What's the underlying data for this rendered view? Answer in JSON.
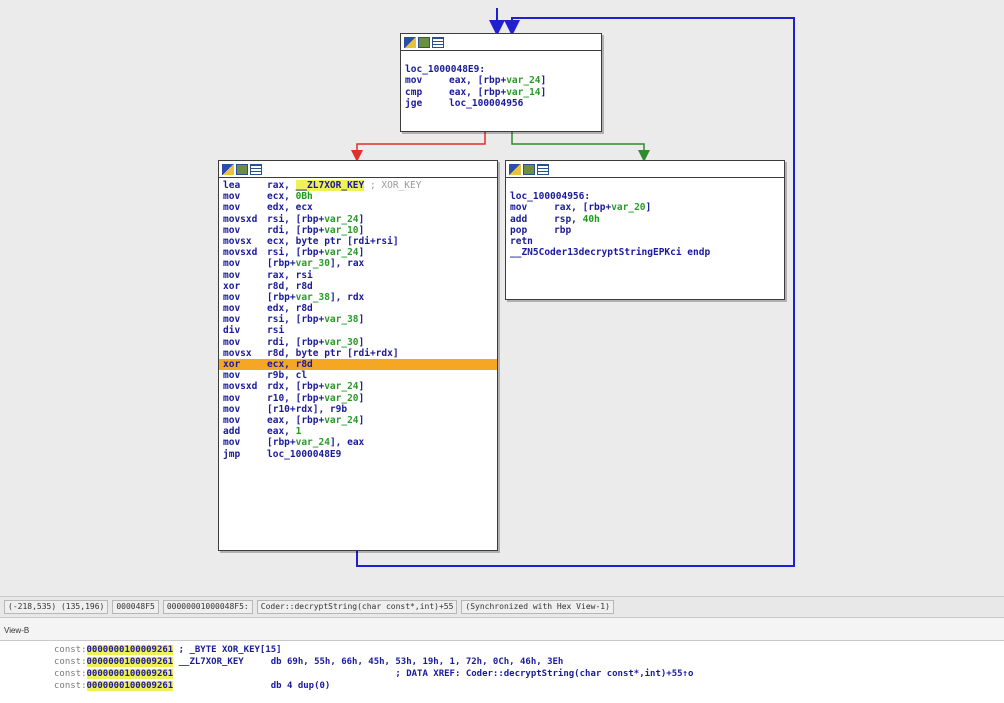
{
  "block_top": {
    "label": "loc_1000048E9:",
    "rows": [
      {
        "mnem": "mov",
        "parts": [
          {
            "t": "eax, [rbp+",
            "c": "op"
          },
          {
            "t": "var_24",
            "c": "var"
          },
          {
            "t": "]",
            "c": "op"
          }
        ]
      },
      {
        "mnem": "cmp",
        "parts": [
          {
            "t": "eax, [rbp+",
            "c": "op"
          },
          {
            "t": "var_14",
            "c": "var"
          },
          {
            "t": "]",
            "c": "op"
          }
        ]
      },
      {
        "mnem": "jge",
        "parts": [
          {
            "t": "loc_100004956",
            "c": "op"
          }
        ]
      }
    ]
  },
  "block_left": {
    "rows": [
      {
        "mnem": "lea",
        "parts": [
          {
            "t": "rax, ",
            "c": "op"
          },
          {
            "t": "__ZL7XOR_KEY",
            "c": "hl"
          },
          {
            "t": " ; XOR_KEY",
            "c": "cmt"
          }
        ]
      },
      {
        "mnem": "mov",
        "parts": [
          {
            "t": "ecx, ",
            "c": "op"
          },
          {
            "t": "0Bh",
            "c": "imm"
          }
        ]
      },
      {
        "mnem": "mov",
        "parts": [
          {
            "t": "edx, ecx",
            "c": "op"
          }
        ]
      },
      {
        "mnem": "movsxd",
        "parts": [
          {
            "t": "rsi, [rbp+",
            "c": "op"
          },
          {
            "t": "var_24",
            "c": "var"
          },
          {
            "t": "]",
            "c": "op"
          }
        ]
      },
      {
        "mnem": "mov",
        "parts": [
          {
            "t": "rdi, [rbp+",
            "c": "op"
          },
          {
            "t": "var_10",
            "c": "var"
          },
          {
            "t": "]",
            "c": "op"
          }
        ]
      },
      {
        "mnem": "movsx",
        "parts": [
          {
            "t": "ecx, byte ptr [rdi+rsi]",
            "c": "op"
          }
        ]
      },
      {
        "mnem": "movsxd",
        "parts": [
          {
            "t": "rsi, [rbp+",
            "c": "op"
          },
          {
            "t": "var_24",
            "c": "var"
          },
          {
            "t": "]",
            "c": "op"
          }
        ]
      },
      {
        "mnem": "mov",
        "parts": [
          {
            "t": "[rbp+",
            "c": "op"
          },
          {
            "t": "var_30",
            "c": "var"
          },
          {
            "t": "], rax",
            "c": "op"
          }
        ]
      },
      {
        "mnem": "mov",
        "parts": [
          {
            "t": "rax, rsi",
            "c": "op"
          }
        ]
      },
      {
        "mnem": "xor",
        "parts": [
          {
            "t": "r8d, r8d",
            "c": "op"
          }
        ]
      },
      {
        "mnem": "mov",
        "parts": [
          {
            "t": "[rbp+",
            "c": "op"
          },
          {
            "t": "var_38",
            "c": "var"
          },
          {
            "t": "], rdx",
            "c": "op"
          }
        ]
      },
      {
        "mnem": "mov",
        "parts": [
          {
            "t": "edx, r8d",
            "c": "op"
          }
        ]
      },
      {
        "mnem": "mov",
        "parts": [
          {
            "t": "rsi, [rbp+",
            "c": "op"
          },
          {
            "t": "var_38",
            "c": "var"
          },
          {
            "t": "]",
            "c": "op"
          }
        ]
      },
      {
        "mnem": "div",
        "parts": [
          {
            "t": "rsi",
            "c": "op"
          }
        ]
      },
      {
        "mnem": "mov",
        "parts": [
          {
            "t": "rdi, [rbp+",
            "c": "op"
          },
          {
            "t": "var_30",
            "c": "var"
          },
          {
            "t": "]",
            "c": "op"
          }
        ]
      },
      {
        "mnem": "movsx",
        "parts": [
          {
            "t": "r8d, byte ptr [rdi+rdx]",
            "c": "op"
          }
        ]
      },
      {
        "mnem": "xor",
        "parts": [
          {
            "t": "ecx, r8d",
            "c": "op"
          }
        ],
        "sel": true
      },
      {
        "mnem": "mov",
        "parts": [
          {
            "t": "r9b, cl",
            "c": "op"
          }
        ]
      },
      {
        "mnem": "movsxd",
        "parts": [
          {
            "t": "rdx, [rbp+",
            "c": "op"
          },
          {
            "t": "var_24",
            "c": "var"
          },
          {
            "t": "]",
            "c": "op"
          }
        ]
      },
      {
        "mnem": "mov",
        "parts": [
          {
            "t": "r10, [rbp+",
            "c": "op"
          },
          {
            "t": "var_20",
            "c": "var"
          },
          {
            "t": "]",
            "c": "op"
          }
        ]
      },
      {
        "mnem": "mov",
        "parts": [
          {
            "t": "[r10+rdx], r9b",
            "c": "op"
          }
        ]
      },
      {
        "mnem": "mov",
        "parts": [
          {
            "t": "eax, [rbp+",
            "c": "op"
          },
          {
            "t": "var_24",
            "c": "var"
          },
          {
            "t": "]",
            "c": "op"
          }
        ]
      },
      {
        "mnem": "add",
        "parts": [
          {
            "t": "eax, ",
            "c": "op"
          },
          {
            "t": "1",
            "c": "imm"
          }
        ]
      },
      {
        "mnem": "mov",
        "parts": [
          {
            "t": "[rbp+",
            "c": "op"
          },
          {
            "t": "var_24",
            "c": "var"
          },
          {
            "t": "], eax",
            "c": "op"
          }
        ]
      },
      {
        "mnem": "jmp",
        "parts": [
          {
            "t": "loc_1000048E9",
            "c": "op"
          }
        ]
      }
    ]
  },
  "block_right": {
    "label": "loc_100004956:",
    "rows": [
      {
        "mnem": "mov",
        "parts": [
          {
            "t": "rax, [rbp+",
            "c": "op"
          },
          {
            "t": "var_20",
            "c": "var"
          },
          {
            "t": "]",
            "c": "op"
          }
        ]
      },
      {
        "mnem": "add",
        "parts": [
          {
            "t": "rsp, ",
            "c": "op"
          },
          {
            "t": "40h",
            "c": "imm"
          }
        ]
      },
      {
        "mnem": "pop",
        "parts": [
          {
            "t": "rbp",
            "c": "op"
          }
        ]
      },
      {
        "mnem": "retn",
        "parts": []
      }
    ],
    "endp": "__ZN5Coder13decryptStringEPKci endp"
  },
  "statusbar": {
    "cells": [
      "(-218,535) (135,196)",
      "000048F5",
      "00000001000048F5:",
      "Coder::decryptString(char const*,int)+55",
      "(Synchronized with Hex View-1)"
    ]
  },
  "view_tab": "View-B",
  "hex_view": {
    "rows": [
      {
        "seg": "const:",
        "addr": "0000000100009261",
        "rest": " ; _BYTE XOR_KEY[15]"
      },
      {
        "seg": "const:",
        "addr": "0000000100009261",
        "rest": " __ZL7XOR_KEY     db 69h, 55h, 66h, 45h, 53h, 19h, 1, 72h, 0Ch, 46h, 3Eh"
      },
      {
        "seg": "const:",
        "addr": "0000000100009261",
        "rest": "                                         ; DATA XREF: Coder::decryptString(char const*,int)+55↑o"
      },
      {
        "seg": "const:",
        "addr": "0000000100009261",
        "rest": "                  db 4 dup(0)"
      }
    ]
  },
  "colors": {
    "edge_false": "#e0302a",
    "edge_true": "#2e8b2e",
    "edge_back": "#2020d0",
    "selected_row": "#f5a623",
    "highlight": "#f0f05a"
  },
  "icons": [
    "flow-chart-icon",
    "graph-view-icon",
    "text-view-icon"
  ]
}
